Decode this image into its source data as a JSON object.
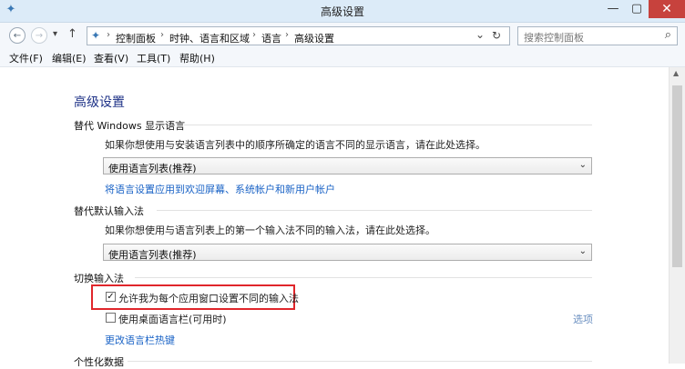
{
  "window": {
    "title": "高级设置",
    "minimize": "—",
    "maximize": "▢",
    "close": "✕"
  },
  "nav": {
    "back": "←",
    "forward": "→",
    "history": "▾",
    "up": "↑",
    "breadcrumbs": [
      "控制面板",
      "时钟、语言和区域",
      "语言",
      "高级设置"
    ],
    "separator": "›",
    "dropdown": "⌄",
    "refresh": "↻",
    "search_placeholder": "搜索控制面板",
    "search_icon": "⌕"
  },
  "menu": [
    "文件(F)",
    "编辑(E)",
    "查看(V)",
    "工具(T)",
    "帮助(H)"
  ],
  "page": {
    "heading": "高级设置",
    "display_language": {
      "title": "替代 Windows 显示语言",
      "description": "如果你想使用与安装语言列表中的顺序所确定的语言不同的显示语言，请在此处选择。",
      "select_value": "使用语言列表(推荐)",
      "link": "将语言设置应用到欢迎屏幕、系统帐户和新用户帐户"
    },
    "default_input": {
      "title": "替代默认输入法",
      "description": "如果你想使用与语言列表上的第一个输入法不同的输入法，请在此处选择。",
      "select_value": "使用语言列表(推荐)"
    },
    "switch_input": {
      "title": "切换输入法",
      "per_app_label": "允许我为每个应用窗口设置不同的输入法",
      "per_app_checked": true,
      "desktop_bar_label": "使用桌面语言栏(可用时)",
      "desktop_bar_checked": false,
      "options_link": "选项",
      "hotkeys_link": "更改语言栏热键"
    },
    "personalization": {
      "title": "个性化数据"
    }
  },
  "colors": {
    "highlight": "#e0262b",
    "link": "#1a63c6",
    "heading": "#1e3287"
  }
}
